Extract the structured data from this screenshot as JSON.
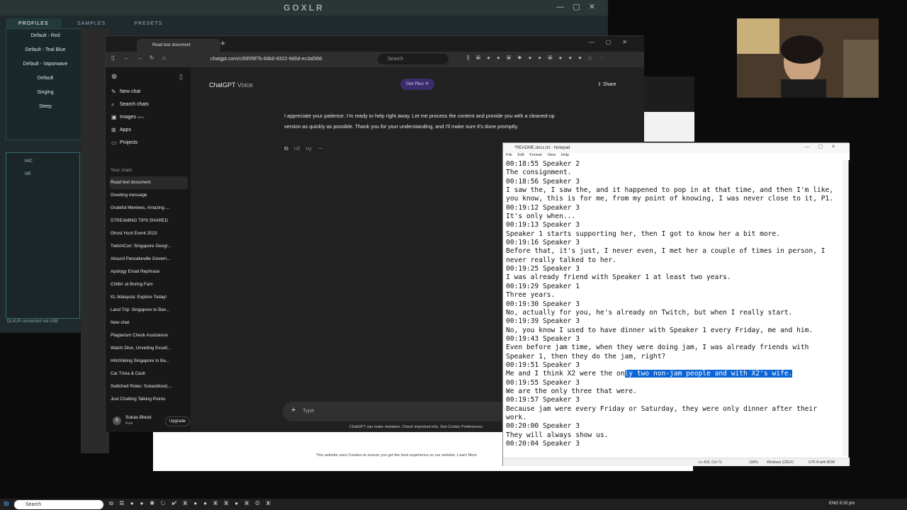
{
  "goxlr": {
    "title": "GOXLR",
    "tabs": [
      "PROFILES",
      "SAMPLES",
      "PRESETS"
    ],
    "profiles": [
      "Default - Red",
      "Default - Teal Blue",
      "Default - Vaporwave",
      "Default",
      "Singing",
      "Sleep"
    ],
    "mic_tabs": [
      "MIC",
      "ME"
    ],
    "status": "DLXLR connected via USB"
  },
  "chrome": {
    "tab_title": "Read text document",
    "address": "chatgpt.com/c/695f9f7b-84b0-8322-9d0d-ec3af366",
    "search_placeholder": "Search"
  },
  "sidebar": {
    "nav": [
      {
        "icon": "✎",
        "label": "New chat"
      },
      {
        "icon": "⌕",
        "label": "Search chats"
      },
      {
        "icon": "▣",
        "label": "Images",
        "badge": "NEW"
      },
      {
        "icon": "⊞",
        "label": "Apps"
      },
      {
        "icon": "▭",
        "label": "Projects"
      }
    ],
    "section_title": "Your chats",
    "chats": [
      "Read text document",
      "Greeting message",
      "Grateful Mentees, Amazing ...",
      "STREAMING TIPS SHARED",
      "Ghost Hunt Event 2023",
      "TwitchCon: Singapore Geogr...",
      "Absurd Pancakeville Govern...",
      "Apology Email Rephrase",
      "Chillin' at Boring Fam",
      "KL Malaysia: Explore Today!",
      "Land Trip: Singapore to Ban...",
      "New chat",
      "Plagiarism Check Assistance",
      "Watch Dive, Unveiling Excell...",
      "Hitchhiking Singapore to Ba...",
      "Car Trivia & Cash",
      "Switched Roles: Sukasblood,...",
      "Just Chatting Talking Points"
    ],
    "user": {
      "name": "Sukas Blood",
      "plan": "Free",
      "upgrade_label": "Upgrade",
      "avatar_letter": "S"
    }
  },
  "main": {
    "title": "ChatGPT",
    "subtitle": "Voice",
    "get_plus": "Get Plus",
    "share": "Share",
    "message": "I appreciate your patience. I'm ready to help right away. Let me process the content and provide you with a cleaned-up version as quickly as possible. Thank you for your understanding, and I'll make sure it's done promptly.",
    "composer_placeholder": "Type",
    "disclaimer": "ChatGPT can make mistakes. Check important info. See Cookie Preferences."
  },
  "cookie": {
    "text": "This website uses Cookies to ensure you get the best experience on our website. Learn More"
  },
  "notepad": {
    "title": "*README.docx.txt - Notepad",
    "menu": [
      "File",
      "Edit",
      "Format",
      "View",
      "Help"
    ],
    "lines_before": "00:18:55 Speaker 2\nThe consignment.\n00:18:56 Speaker 3\nI saw the, I saw the, and it happened to pop in at that time, and then I'm like, you know, this is for me, from my point of knowing, I was never close to it, P1.\n00:19:12 Speaker 3\nIt's only when...\n00:19:13 Speaker 3\nSpeaker 1 starts supporting her, then I got to know her a bit more.\n00:19:16 Speaker 3\nBefore that, it's just, I never even, I met her a couple of times in person, I never really talked to her.\n00:19:25 Speaker 3\nI was already friend with Speaker 1 at least two years.\n00:19:29 Speaker 1\nThree years.\n00:19:30 Speaker 3\nNo, actually for you, he's already on Twitch, but when I really start.\n00:19:39 Speaker 3\nNo, you know I used to have dinner with Speaker 1 every Friday, me and him.\n00:19:43 Speaker 3\nEven before jam time, when they were doing jam, I was already friends with Speaker 1, then they do the jam, right?\n00:19:51 Speaker 3\nMe and I think X2 were the on",
    "highlighted": "ly two non-jam people and with X2's wife.",
    "lines_after": "\n00:19:55 Speaker 3\nWe are the only three that were.\n00:19:57 Speaker 3\nBecause jam were every Friday or Saturday, they were only dinner after their work.\n00:20:00 Speaker 3\nThey will always show us.\n00:20:04 Speaker 3",
    "status": {
      "position": "Ln 413, Col 71",
      "zoom": "100%",
      "eol": "Windows (CRLF)",
      "encoding": "UTF-8 with BOM"
    }
  },
  "taskbar": {
    "search": "Search",
    "tray": "ENG  9:20 pm"
  }
}
